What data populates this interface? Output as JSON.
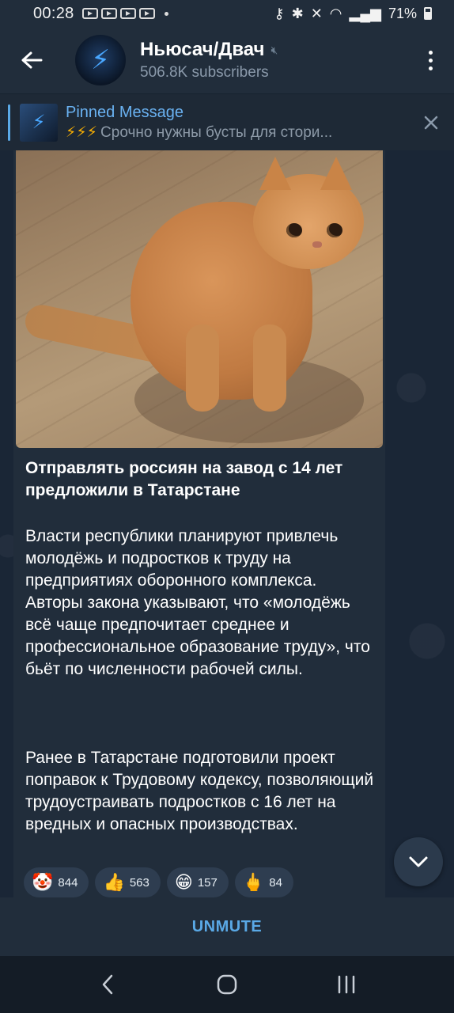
{
  "status_bar": {
    "time": "00:28",
    "battery": "71%"
  },
  "header": {
    "title": "Ньюсач/Двач",
    "subscribers": "506.8K subscribers"
  },
  "pinned": {
    "title": "Pinned Message",
    "bolts": "⚡⚡⚡",
    "text": "Срочно нужны бусты для стори..."
  },
  "message": {
    "title": "Отправлять россиян на завод с 14 лет предложили в Татарстане",
    "paragraph1": "Власти республики планируют привлечь молодёжь и подростков к труду на предприятиях оборонного комплекса. Авторы закона указывают, что «молодёжь всё чаще предпочитает среднее и профессиональное образование труду», что бьёт по численности рабочей силы.",
    "paragraph2": "Ранее в Татарстане подготовили проект поправок к Трудовому кодексу, позволяющий трудоустраивать подростков с 16 лет на вредных и опасных производствах."
  },
  "reactions": [
    {
      "emoji": "🤡",
      "count": "844"
    },
    {
      "emoji": "👍",
      "count": "563"
    },
    {
      "emoji": "😁",
      "count": "157"
    },
    {
      "emoji": "🖕",
      "count": "84"
    }
  ],
  "bottom_bar": {
    "unmute_label": "UNMUTE"
  },
  "icons": {
    "back": "back-arrow-icon",
    "menu": "more-vertical-icon",
    "close": "close-icon",
    "scroll": "chevron-down-icon"
  },
  "colors": {
    "accent": "#5aa9e6",
    "header_bg": "#212d3b",
    "chat_bg": "#1a2636",
    "bubble_bg": "#212d3b"
  }
}
